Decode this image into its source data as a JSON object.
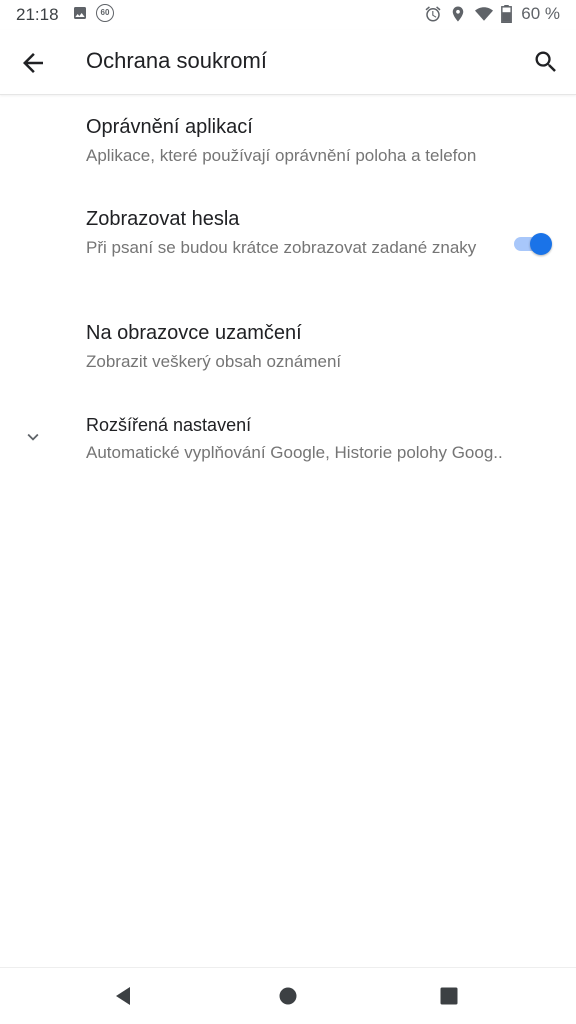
{
  "status_bar": {
    "time": "21:18",
    "badge": "60",
    "battery": "60 %",
    "icons": [
      "image-icon",
      "alarm-icon",
      "location-icon",
      "wifi-icon",
      "battery-icon"
    ]
  },
  "app_bar": {
    "title": "Ochrana soukromí"
  },
  "settings": {
    "app_permissions": {
      "title": "Oprávnění aplikací",
      "summary": "Aplikace, které používají oprávnění poloha a telefon"
    },
    "show_passwords": {
      "title": "Zobrazovat hesla",
      "summary": "Při psaní se budou krátce zobrazovat zadané znaky",
      "enabled": true
    },
    "lock_screen": {
      "title": "Na obrazovce uzamčení",
      "summary": "Zobrazit veškerý obsah oznámení"
    },
    "advanced": {
      "title": "Rozšířená nastavení",
      "summary": "Automatické vyplňování Google, Historie polohy Goog.."
    }
  },
  "colors": {
    "accent": "#1a73e8",
    "accent_track": "#a8c7fa",
    "title_text": "#202124",
    "summary_text": "#757575"
  }
}
